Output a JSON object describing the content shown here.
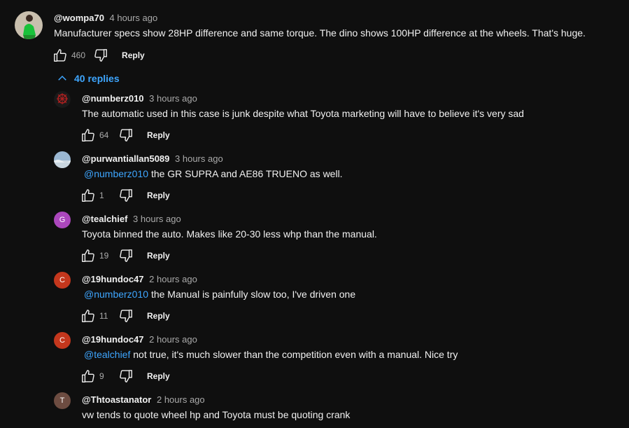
{
  "top_comment": {
    "author": "@wompa70",
    "time": "4 hours ago",
    "text": "Manufacturer specs show 28HP difference and same torque. The dino shows 100HP difference at the wheels. That's huge.",
    "likes": "460",
    "reply_label": "Reply"
  },
  "replies_toggle": {
    "label": "40 replies",
    "icon": "chevron-up-icon"
  },
  "replies": [
    {
      "author": "@numberz010",
      "time": "3 hours ago",
      "mention": "",
      "text": "The automatic used in this case is junk despite what Toyota marketing will have to believe it's very sad",
      "likes": "64",
      "reply_label": "Reply",
      "avatar_letter": "",
      "avatar_color": "#1a1a1a"
    },
    {
      "author": "@purwantiallan5089",
      "time": "3 hours ago",
      "mention": "@numberz010",
      "text": "the GR SUPRA and AE86 TRUENO as well.",
      "likes": "1",
      "reply_label": "Reply",
      "avatar_letter": "",
      "avatar_color": "#8fa8c0"
    },
    {
      "author": "@tealchief",
      "time": "3 hours ago",
      "mention": "",
      "text": "Toyota binned the auto. Makes like 20-30 less whp than the manual.",
      "likes": "19",
      "reply_label": "Reply",
      "avatar_letter": "G",
      "avatar_color": "#ab47bc"
    },
    {
      "author": "@19hundoc47",
      "time": "2 hours ago",
      "mention": "@numberz010",
      "text": "the Manual is painfully slow too, I've driven one",
      "likes": "11",
      "reply_label": "Reply",
      "avatar_letter": "C",
      "avatar_color": "#c4371d"
    },
    {
      "author": "@19hundoc47",
      "time": "2 hours ago",
      "mention": "@tealchief",
      "text": "not true, it's much slower than the competition even with a manual. Nice try",
      "likes": "9",
      "reply_label": "Reply",
      "avatar_letter": "C",
      "avatar_color": "#c4371d"
    },
    {
      "author": "@Thtoastanator",
      "time": "2 hours ago",
      "mention": "",
      "text": "vw tends to quote wheel hp and Toyota must be quoting crank",
      "likes": "",
      "reply_label": "",
      "avatar_letter": "T",
      "avatar_color": "#6d4c41"
    }
  ],
  "colors": {
    "background": "#0f0f0f",
    "link": "#3ea6ff",
    "muted": "#aaaaaa"
  }
}
